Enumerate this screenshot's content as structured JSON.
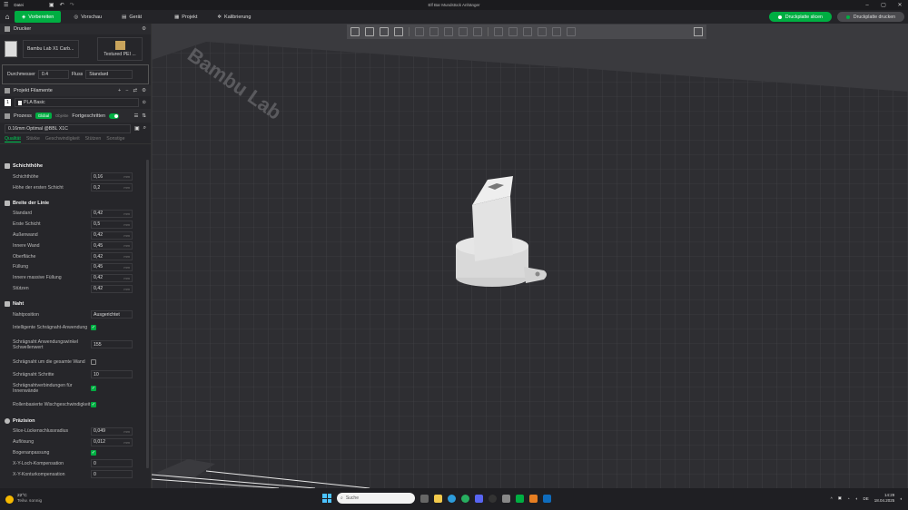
{
  "window": {
    "title": "Elf Bar Mundstück Anhänger",
    "menu_label": "Datei"
  },
  "nav": {
    "tabs": [
      {
        "label": "Vorbereiten"
      },
      {
        "label": "Vorschau"
      },
      {
        "label": "Gerät"
      },
      {
        "label": "Projekt"
      },
      {
        "label": "Kalibrierung"
      }
    ],
    "slice_button": "Druckplatte slicen",
    "print_button": "Druckplatte drucken"
  },
  "printer": {
    "section": "Drucker",
    "name": "Bambu Lab X1 Carb...",
    "plate": "Textured PEI ...",
    "diameter_label": "Durchmesser",
    "diameter_value": "0.4",
    "flow_label": "Fluss",
    "flow_value": "Standard"
  },
  "filament": {
    "section": "Projekt Filamente",
    "slot": "1",
    "name": "PLA Basic"
  },
  "process": {
    "section": "Prozess",
    "badge_global": "Global",
    "badge_objects": "Objekte",
    "advanced_label": "Fortgeschritten",
    "preset": "0.16mm Optimal @BBL X1C"
  },
  "tabs": [
    "Qualität",
    "Stärke",
    "Geschwindigkeit",
    "Stützen",
    "Sonstige"
  ],
  "sections": {
    "layer": {
      "title": "Schichthöhe",
      "rows": [
        {
          "label": "Schichthöhe",
          "value": "0,16",
          "unit": "mm"
        },
        {
          "label": "Höhe der ersten Schicht",
          "value": "0,2",
          "unit": "mm"
        }
      ]
    },
    "width": {
      "title": "Breite der Linie",
      "rows": [
        {
          "label": "Standard",
          "value": "0,42",
          "unit": "mm"
        },
        {
          "label": "Erste Schicht",
          "value": "0,5",
          "unit": "mm"
        },
        {
          "label": "Außenwand",
          "value": "0,42",
          "unit": "mm"
        },
        {
          "label": "Innere Wand",
          "value": "0,45",
          "unit": "mm"
        },
        {
          "label": "Oberfläche",
          "value": "0,42",
          "unit": "mm"
        },
        {
          "label": "Füllung",
          "value": "0,45",
          "unit": "mm"
        },
        {
          "label": "Innere massive Füllung",
          "value": "0,42",
          "unit": "mm"
        },
        {
          "label": "Stützen",
          "value": "0,42",
          "unit": "mm"
        }
      ]
    },
    "seam": {
      "title": "Naht",
      "position_label": "Nahtposition",
      "position_value": "Ausgerichtet",
      "smart_label": "Intelligente Schrägnaht-Anwendung",
      "threshold_label": "Schrägnaht Anwendungswinkel Schwellenwert",
      "threshold_value": "155",
      "whole_wall_label": "Schrägnaht um die gesamte Wand",
      "steps_label": "Schrägnaht Schritte",
      "steps_value": "10",
      "inner_label": "Schrägnahtverbindungen für Innenwände",
      "role_label": "Rollenbasierte Wischgeschwindigkeit"
    },
    "precision": {
      "title": "Präzision",
      "rows": [
        {
          "label": "Slice-Lückenschlussradius",
          "value": "0,049",
          "unit": "mm"
        },
        {
          "label": "Auflösung",
          "value": "0,012",
          "unit": "mm"
        }
      ],
      "arc_label": "Bogenanpassung",
      "xy_hole_label": "X-Y-Loch-Kompensation",
      "xy_hole_value": "0",
      "xy_contour_label": "X-Y-Konturkompensation",
      "xy_contour_value": "0"
    }
  },
  "viewport": {
    "bed_brand": "Bambu Lab"
  },
  "taskbar": {
    "temp": "22°C",
    "weather": "Teilw. sonnig",
    "search": "Suche",
    "time": "14:29",
    "date": "18.04.2025",
    "lang": "DE"
  }
}
